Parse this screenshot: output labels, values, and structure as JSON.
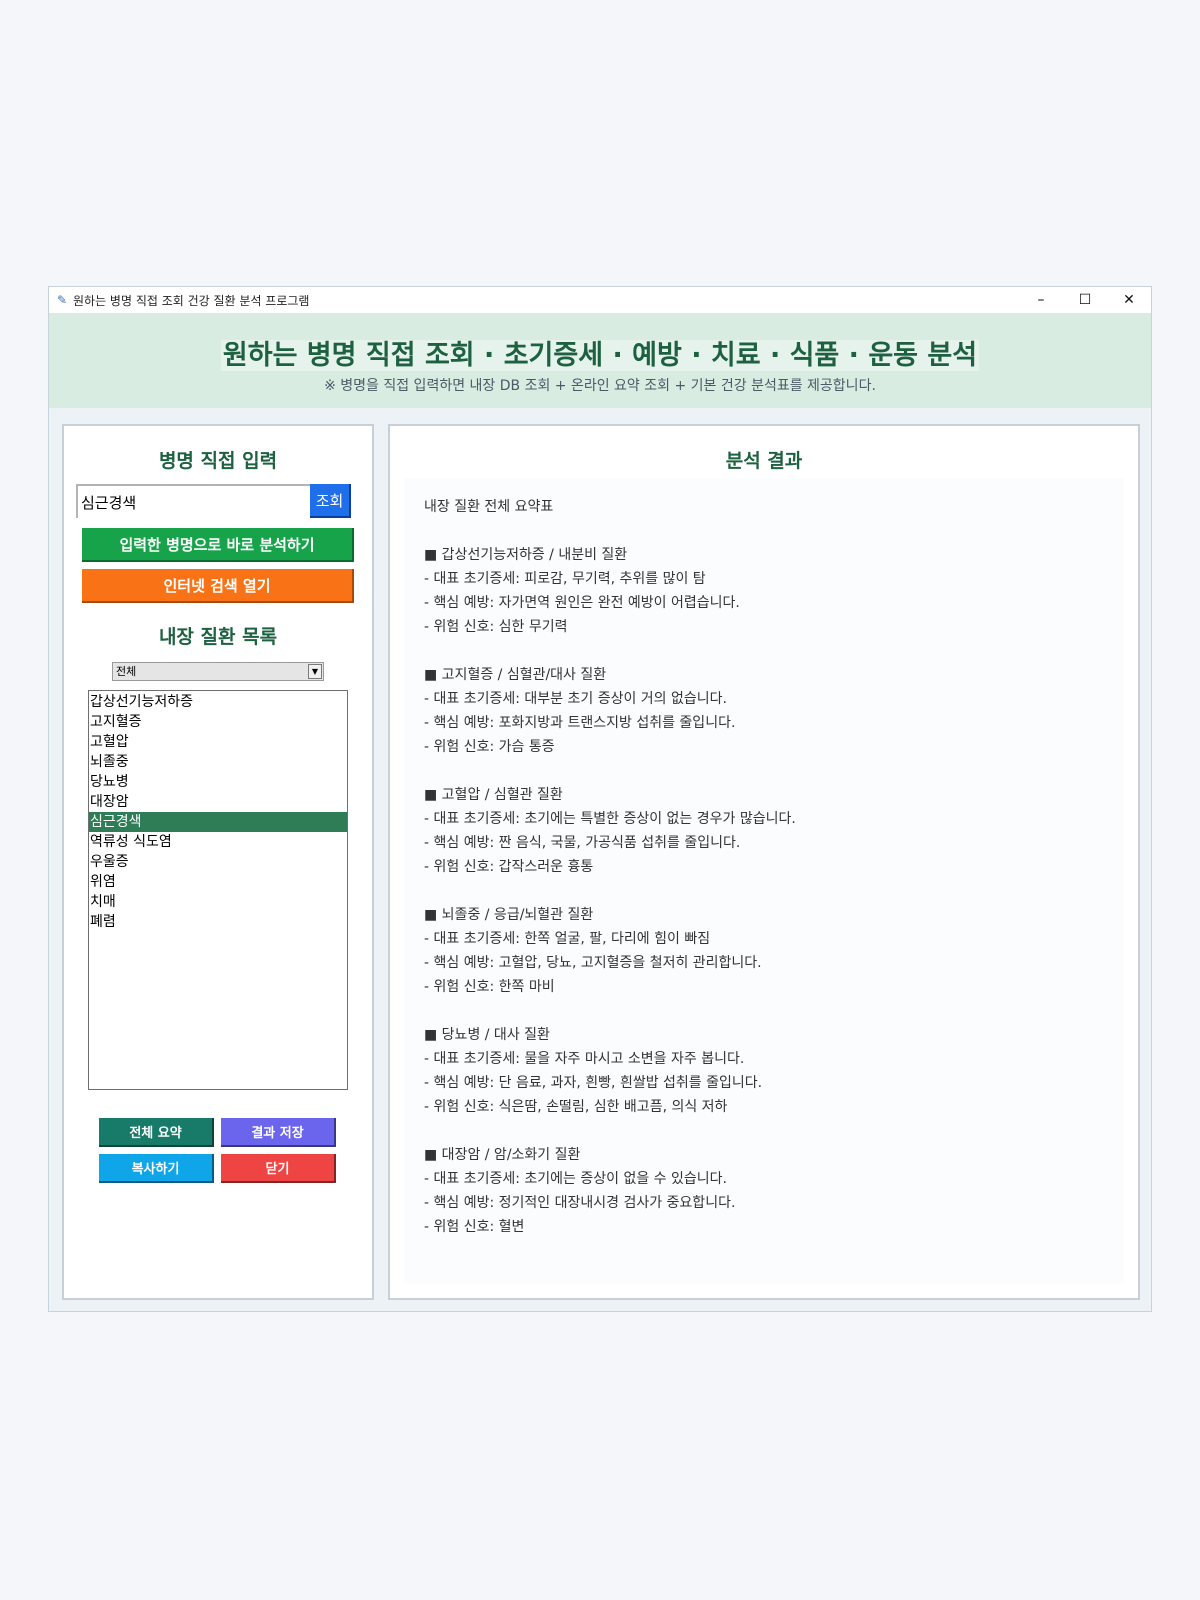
{
  "window": {
    "title": "원하는 병명 직접 조회 건강 질환 분석 프로그램",
    "minimize_glyph": "–",
    "maximize_glyph": "☐",
    "close_glyph": "✕",
    "app_icon": "feather-icon"
  },
  "header": {
    "title": "원하는 병명 직접 조회 · 초기증세 · 예방 · 치료 · 식품 · 운동 분석",
    "subtitle": "※ 병명을 직접 입력하면 내장 DB 조회 + 온라인 요약 조회 + 기본 건강 분석표를 제공합니다."
  },
  "left": {
    "input_heading": "병명 직접 입력",
    "search_value": "심근경색",
    "search_button": "조회",
    "analyze_button": "입력한 병명으로 바로 분석하기",
    "web_search_button": "인터넷 검색 열기",
    "list_heading": "내장 질환 목록",
    "category_selected": "전체",
    "diseases": [
      "갑상선기능저하증",
      "고지혈증",
      "고혈압",
      "뇌졸중",
      "당뇨병",
      "대장암",
      "심근경색",
      "역류성 식도염",
      "우울증",
      "위염",
      "치매",
      "폐렴"
    ],
    "selected_index": 6,
    "summary_button": "전체 요약",
    "save_button": "결과 저장",
    "copy_button": "복사하기",
    "close_button": "닫기"
  },
  "right": {
    "heading": "분석 결과",
    "lines": [
      "내장 질환 전체 요약표",
      "",
      "■ 갑상선기능저하증 / 내분비 질환",
      "  - 대표 초기증세: 피로감, 무기력, 추위를 많이 탐",
      "  - 핵심 예방: 자가면역 원인은 완전 예방이 어렵습니다.",
      "  - 위험 신호: 심한 무기력",
      "",
      "■ 고지혈증 / 심혈관/대사 질환",
      "  - 대표 초기증세: 대부분 초기 증상이 거의 없습니다.",
      "  - 핵심 예방: 포화지방과 트랜스지방 섭취를 줄입니다.",
      "  - 위험 신호: 가슴 통증",
      "",
      "■ 고혈압 / 심혈관 질환",
      "  - 대표 초기증세: 초기에는 특별한 증상이 없는 경우가 많습니다.",
      "  - 핵심 예방: 짠 음식, 국물, 가공식품 섭취를 줄입니다.",
      "  - 위험 신호: 갑작스러운 흉통",
      "",
      "■ 뇌졸중 / 응급/뇌혈관 질환",
      "  - 대표 초기증세: 한쪽 얼굴, 팔, 다리에 힘이 빠짐",
      "  - 핵심 예방: 고혈압, 당뇨, 고지혈증을 철저히 관리합니다.",
      "  - 위험 신호: 한쪽 마비",
      "",
      "■ 당뇨병 / 대사 질환",
      "  - 대표 초기증세: 물을 자주 마시고 소변을 자주 봅니다.",
      "  - 핵심 예방: 단 음료, 과자, 흰빵, 흰쌀밥 섭취를 줄입니다.",
      "  - 위험 신호: 식은땀, 손떨림, 심한 배고픔, 의식 저하",
      "",
      "■ 대장암 / 암/소화기 질환",
      "  - 대표 초기증세: 초기에는 증상이 없을 수 있습니다.",
      "  - 핵심 예방: 정기적인 대장내시경 검사가 중요합니다.",
      "  - 위험 신호: 혈변"
    ]
  }
}
